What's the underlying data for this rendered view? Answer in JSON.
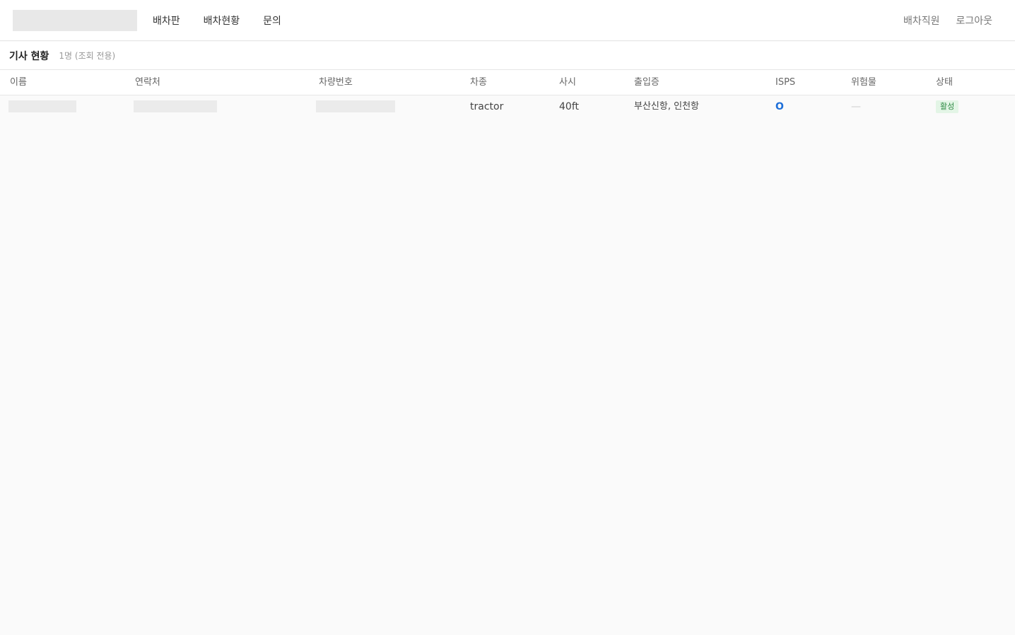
{
  "nav": {
    "items": [
      {
        "label": "배차판"
      },
      {
        "label": "배차현황"
      },
      {
        "label": "문의"
      }
    ]
  },
  "user": {
    "role": "배차직원",
    "logout": "로그아웃"
  },
  "page": {
    "title": "기사 현황",
    "subtitle": "1명 (조회 전용)"
  },
  "table": {
    "columns": [
      "이름",
      "연락처",
      "차량번호",
      "차종",
      "사시",
      "출입증",
      "ISPS",
      "위험물",
      "상태"
    ],
    "rows": [
      {
        "name": "",
        "contact": "",
        "plate": "",
        "vehicle_type": "tractor",
        "chassis": "40ft",
        "pass": "부산신항, 인천항",
        "isps": "O",
        "hazmat": "—",
        "status": "활성"
      }
    ]
  },
  "colors": {
    "accent": "#1e6fd9",
    "status_active_bg": "#e3f5e6",
    "status_active_text": "#2e8a44"
  }
}
